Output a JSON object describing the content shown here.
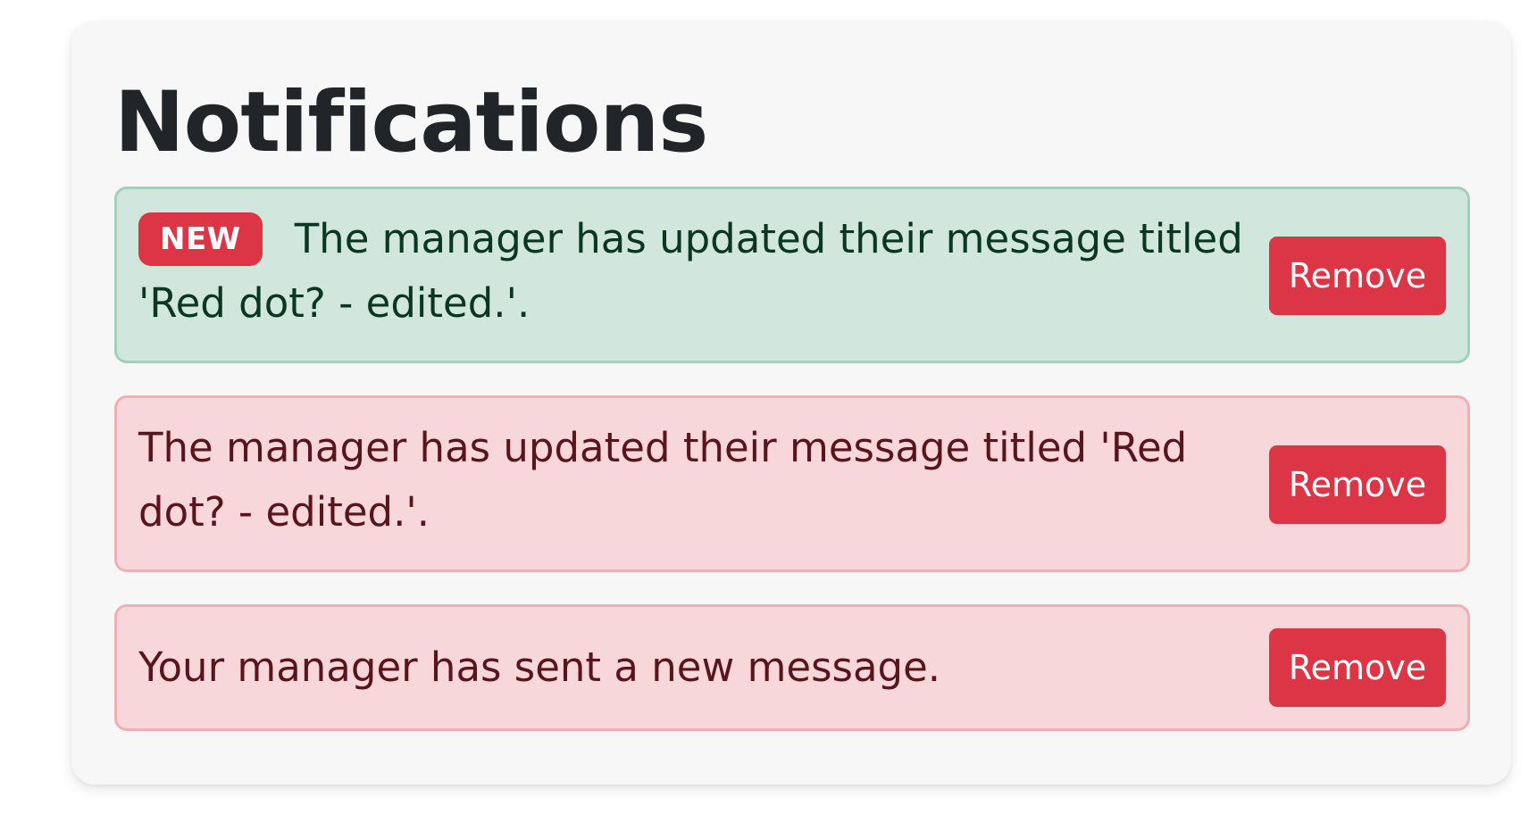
{
  "page": {
    "title": "Notifications"
  },
  "notifications": [
    {
      "type": "success",
      "badge": "NEW",
      "message": "The manager has updated their message titled 'Red dot? - edited.'.",
      "action_label": "Remove"
    },
    {
      "type": "danger",
      "message": "The manager has updated their message titled 'Red dot? - edited.'.",
      "action_label": "Remove"
    },
    {
      "type": "danger",
      "message": "Your manager has sent a new message.",
      "action_label": "Remove"
    }
  ],
  "colors": {
    "success_bg": "#d1e7dd",
    "success_border": "#a3cfbb",
    "danger_bg": "#f8d7da",
    "danger_border": "#f1aeb5",
    "button": "#dc3545",
    "title": "#212529"
  }
}
